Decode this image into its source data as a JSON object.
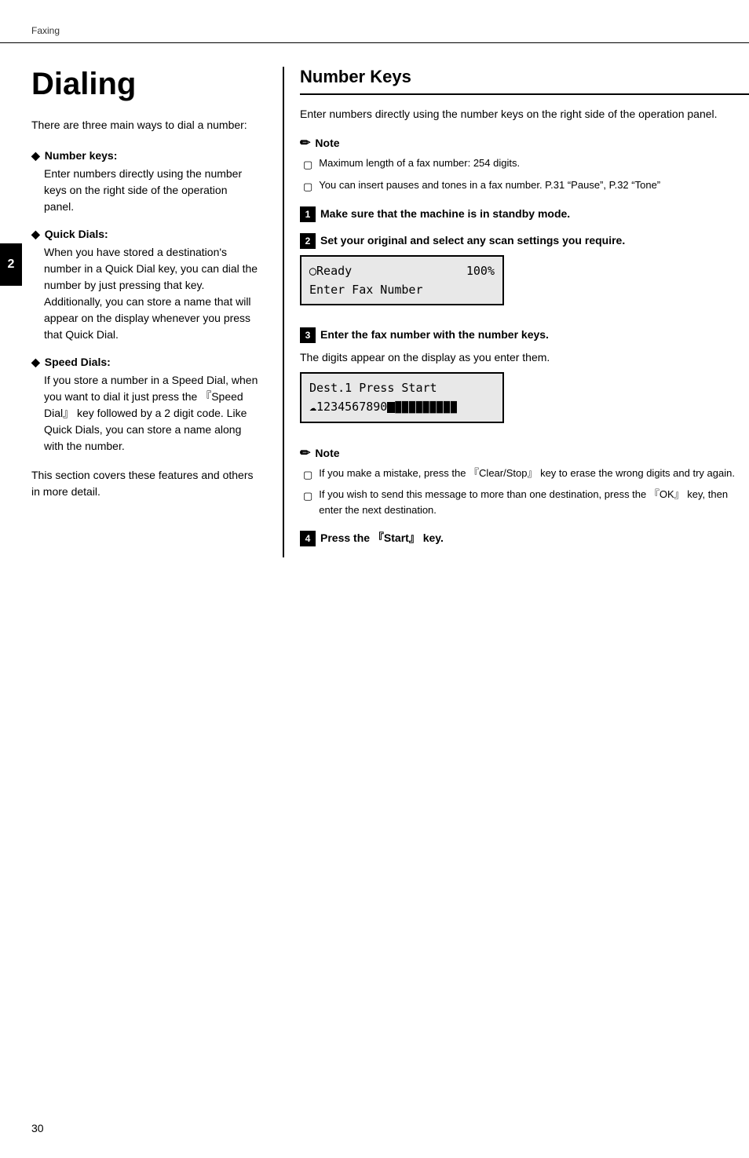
{
  "breadcrumb": "Faxing",
  "sidebar_tab": "2",
  "page_title": "Dialing",
  "intro_text": "There are three main ways to dial a number:",
  "left_sections": [
    {
      "title": "Number keys:",
      "body": "Enter numbers directly using the number keys on the right side of the operation panel."
    },
    {
      "title": "Quick Dials:",
      "body": "When you have stored a destination's number in a Quick Dial key, you can dial the number by just pressing that key. Additionally, you can store a name that will appear on the display whenever you press that Quick Dial."
    },
    {
      "title": "Speed Dials:",
      "body": "If you store a number in a Speed Dial, when you want to dial it just press the 『Speed Dial』 key followed by a 2 digit code. Like Quick Dials, you can store a name along with the number."
    }
  ],
  "bottom_left_text": "This section covers these features and others in more detail.",
  "right_section": {
    "title": "Number Keys",
    "intro": "Enter numbers directly using the number keys on the right side of the operation panel.",
    "note1": {
      "label": "Note",
      "items": [
        "Maximum length of a fax number: 254 digits.",
        "You can insert pauses and tones in a fax number. P.31 “Pause”, P.32 “Tone”"
      ]
    },
    "steps": [
      {
        "number": "1",
        "text": "Make sure that the machine is in standby mode."
      },
      {
        "number": "2",
        "text": "Set your original and select any scan settings you require.",
        "lcd_lines": [
          "○Ready",
          "Enter Fax Number"
        ],
        "lcd_right": "100%"
      },
      {
        "number": "3",
        "text": "Enter the fax number with the number keys.",
        "subtext": "The digits appear on the display as you enter them.",
        "lcd2_line1": "Dest.1      Press Start",
        "lcd2_line2": "☁1234567890"
      }
    ],
    "note2": {
      "label": "Note",
      "items": [
        "If you make a mistake, press the 『Clear/Stop』 key to erase the wrong digits and try again.",
        "If you wish to send this message to more than one destination, press the 『OK』 key, then enter the next destination."
      ]
    },
    "step4": {
      "number": "4",
      "text": "Press the 『Start』 key."
    }
  },
  "page_number": "30"
}
